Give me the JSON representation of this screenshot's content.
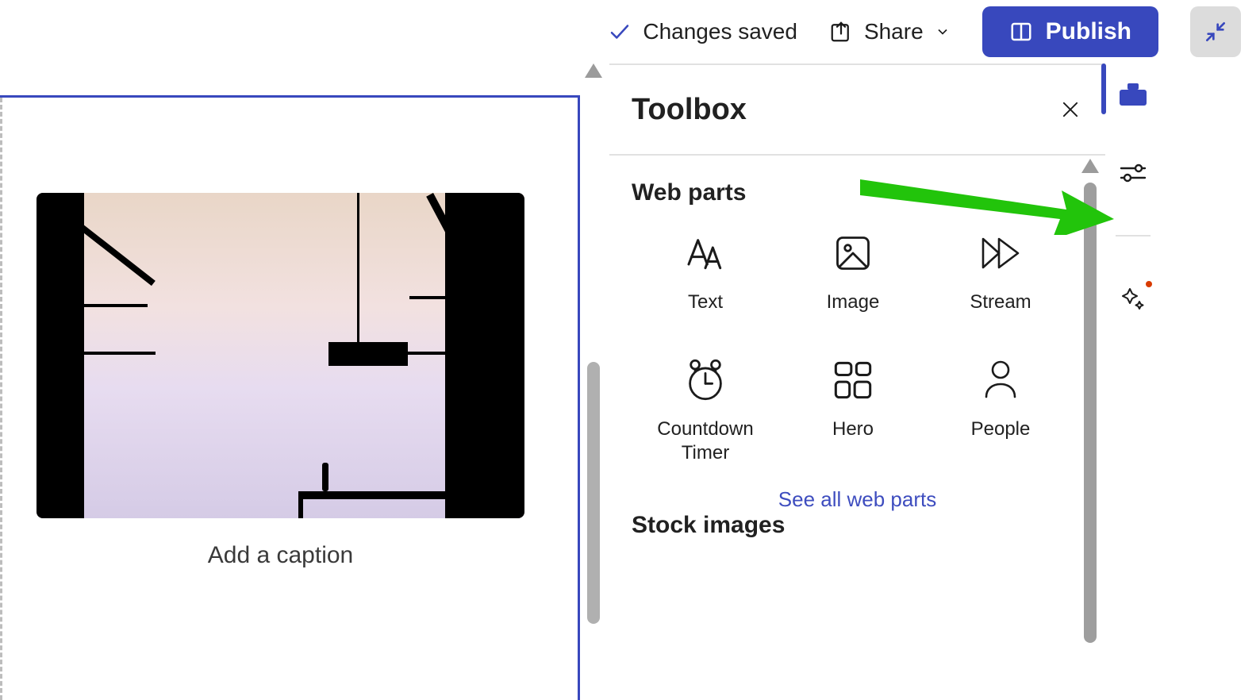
{
  "commandBar": {
    "status": "Changes saved",
    "shareLabel": "Share",
    "publishLabel": "Publish"
  },
  "canvas": {
    "captionPlaceholder": "Add a caption"
  },
  "toolbox": {
    "title": "Toolbox",
    "sectionWebParts": "Web parts",
    "webParts": [
      {
        "label": "Text",
        "icon": "text-icon"
      },
      {
        "label": "Image",
        "icon": "image-icon"
      },
      {
        "label": "Stream",
        "icon": "stream-icon"
      },
      {
        "label": "Countdown Timer",
        "icon": "timer-icon"
      },
      {
        "label": "Hero",
        "icon": "hero-icon"
      },
      {
        "label": "People",
        "icon": "people-icon"
      }
    ],
    "seeAll": "See all web parts",
    "sectionStock": "Stock images"
  },
  "rail": {
    "items": [
      {
        "name": "toolbox-tab",
        "active": true
      },
      {
        "name": "settings-tab",
        "active": false
      },
      {
        "name": "design-tab",
        "active": false,
        "badge": true
      }
    ]
  }
}
